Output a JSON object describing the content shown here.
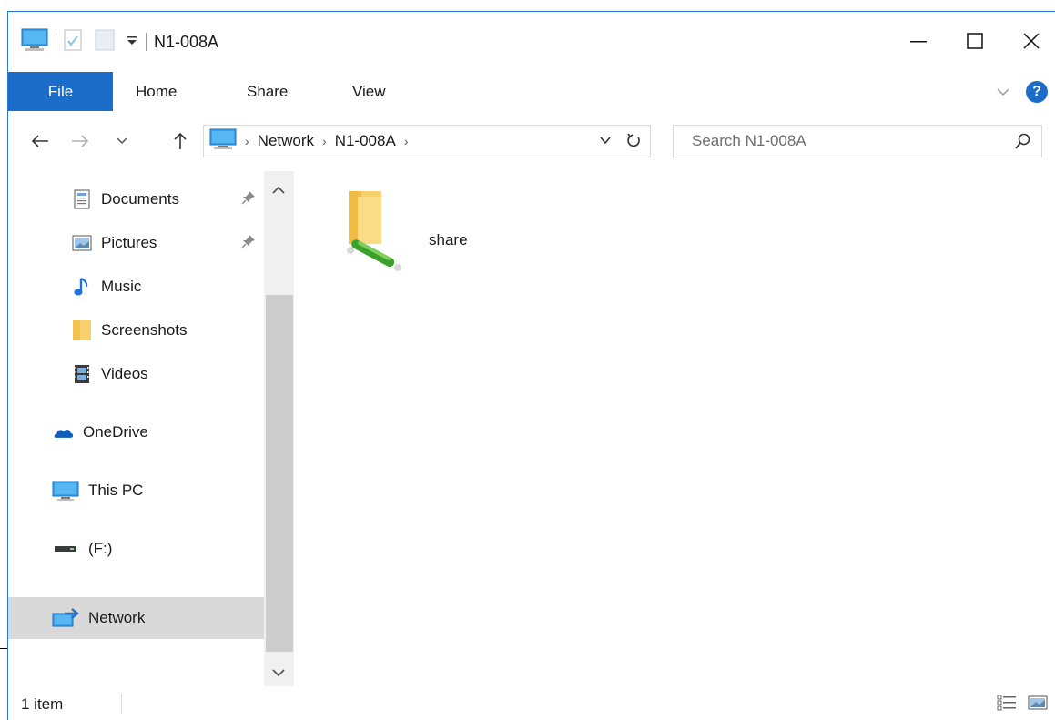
{
  "window": {
    "title": "N1-008A",
    "controls": [
      "—",
      "☐",
      "✕"
    ]
  },
  "ribbon": {
    "tabs": [
      "File",
      "Home",
      "Share",
      "View"
    ],
    "help_glyph": "?"
  },
  "address": {
    "breadcrumbs": [
      "Network",
      "N1-008A"
    ],
    "separator": "›"
  },
  "search": {
    "placeholder": "Search N1-008A"
  },
  "nav": {
    "items": [
      {
        "label": "Documents",
        "pinned": true
      },
      {
        "label": "Pictures",
        "pinned": true
      },
      {
        "label": "Music"
      },
      {
        "label": "Screenshots"
      },
      {
        "label": "Videos"
      },
      {
        "label": "OneDrive"
      },
      {
        "label": "This PC"
      },
      {
        "label": "(F:)"
      },
      {
        "label": "Network",
        "selected": true
      }
    ]
  },
  "content": {
    "items": [
      {
        "name": "share",
        "icon": "network-share-folder-icon"
      }
    ]
  },
  "status": {
    "item_count": "1 item"
  },
  "colors": {
    "accent": "#1c6cc9",
    "selection": "#d9d9d9",
    "folder": "#f7cf6b"
  }
}
